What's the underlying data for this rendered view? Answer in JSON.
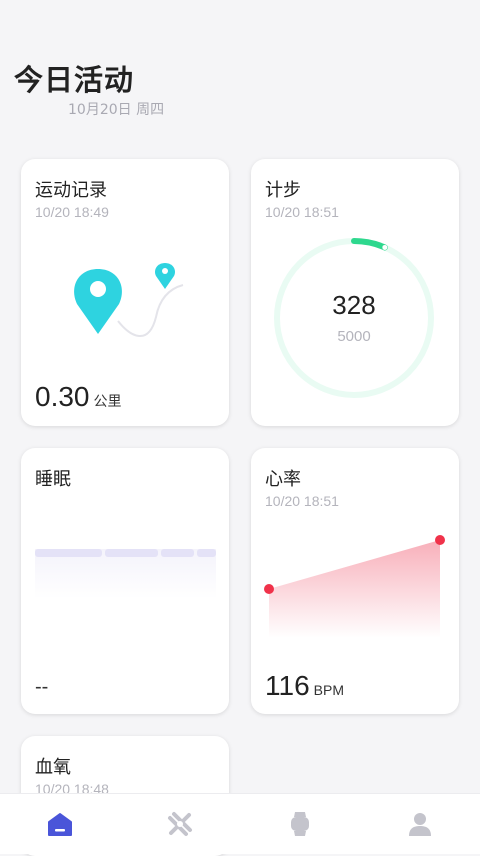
{
  "header": {
    "title": "今日活动",
    "date": "10月20日 周四"
  },
  "cards": {
    "exercise": {
      "title": "运动记录",
      "time": "10/20 18:49",
      "value": "0.30",
      "unit": "公里"
    },
    "steps": {
      "title": "计步",
      "time": "10/20 18:51",
      "value": "328",
      "goal": "5000",
      "progress": 0.0656
    },
    "sleep": {
      "title": "睡眠",
      "value": "--"
    },
    "heart_rate": {
      "title": "心率",
      "time": "10/20 18:51",
      "value": "116",
      "unit": "BPM"
    },
    "blood_oxygen": {
      "title": "血氧",
      "time": "10/20 18:48"
    }
  },
  "tabbar": {
    "items": [
      {
        "icon": "home-icon",
        "active": true
      },
      {
        "icon": "sport-icon",
        "active": false
      },
      {
        "icon": "watch-icon",
        "active": false
      },
      {
        "icon": "profile-icon",
        "active": false
      }
    ]
  },
  "colors": {
    "accent": "#4a55d9",
    "teal": "#2ed3e0",
    "green": "#2ed88e",
    "heart": "#f0324a",
    "sleep": "#e4e2f7"
  }
}
